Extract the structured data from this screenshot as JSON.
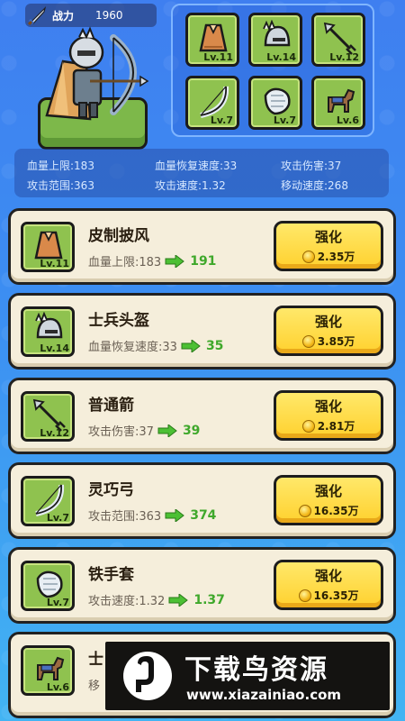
{
  "header": {
    "power_label": "战力",
    "power_value": "1960"
  },
  "equipment": [
    {
      "icon": "cape-icon",
      "level": "Lv.11"
    },
    {
      "icon": "helmet-icon",
      "level": "Lv.14"
    },
    {
      "icon": "arrow-icon",
      "level": "Lv.12"
    },
    {
      "icon": "bow-icon",
      "level": "Lv.7"
    },
    {
      "icon": "gauntlet-icon",
      "level": "Lv.7"
    },
    {
      "icon": "horse-icon",
      "level": "Lv.6"
    }
  ],
  "stats": [
    {
      "text": "血量上限:183"
    },
    {
      "text": "血量恢复速度:33"
    },
    {
      "text": "攻击伤害:37"
    },
    {
      "text": "攻击范围:363"
    },
    {
      "text": "攻击速度:1.32"
    },
    {
      "text": "移动速度:268"
    }
  ],
  "items": [
    {
      "icon": "cape-icon",
      "level": "Lv.11",
      "name": "皮制披风",
      "stat": "血量上限:183",
      "next": "191",
      "button": "强化",
      "cost": "2.35万"
    },
    {
      "icon": "helmet-icon",
      "level": "Lv.14",
      "name": "士兵头盔",
      "stat": "血量恢复速度:33",
      "next": "35",
      "button": "强化",
      "cost": "3.85万"
    },
    {
      "icon": "arrow-icon",
      "level": "Lv.12",
      "name": "普通箭",
      "stat": "攻击伤害:37",
      "next": "39",
      "button": "强化",
      "cost": "2.81万"
    },
    {
      "icon": "bow-icon",
      "level": "Lv.7",
      "name": "灵巧弓",
      "stat": "攻击范围:363",
      "next": "374",
      "button": "强化",
      "cost": "16.35万"
    },
    {
      "icon": "gauntlet-icon",
      "level": "Lv.7",
      "name": "铁手套",
      "stat": "攻击速度:1.32",
      "next": "1.37",
      "button": "强化",
      "cost": "16.35万"
    },
    {
      "icon": "horse-icon",
      "level": "Lv.6",
      "name": "士",
      "stat": "移",
      "next": "",
      "button": "",
      "cost": ""
    }
  ],
  "watermark": {
    "title": "下载鸟资源",
    "url": "www.xiazainiao.com"
  },
  "colors": {
    "card_bg": "#f5eedb",
    "slot_green": "#8fc24f",
    "button_yellow": "#ffd12e",
    "upgrade_green": "#3fa82b"
  }
}
